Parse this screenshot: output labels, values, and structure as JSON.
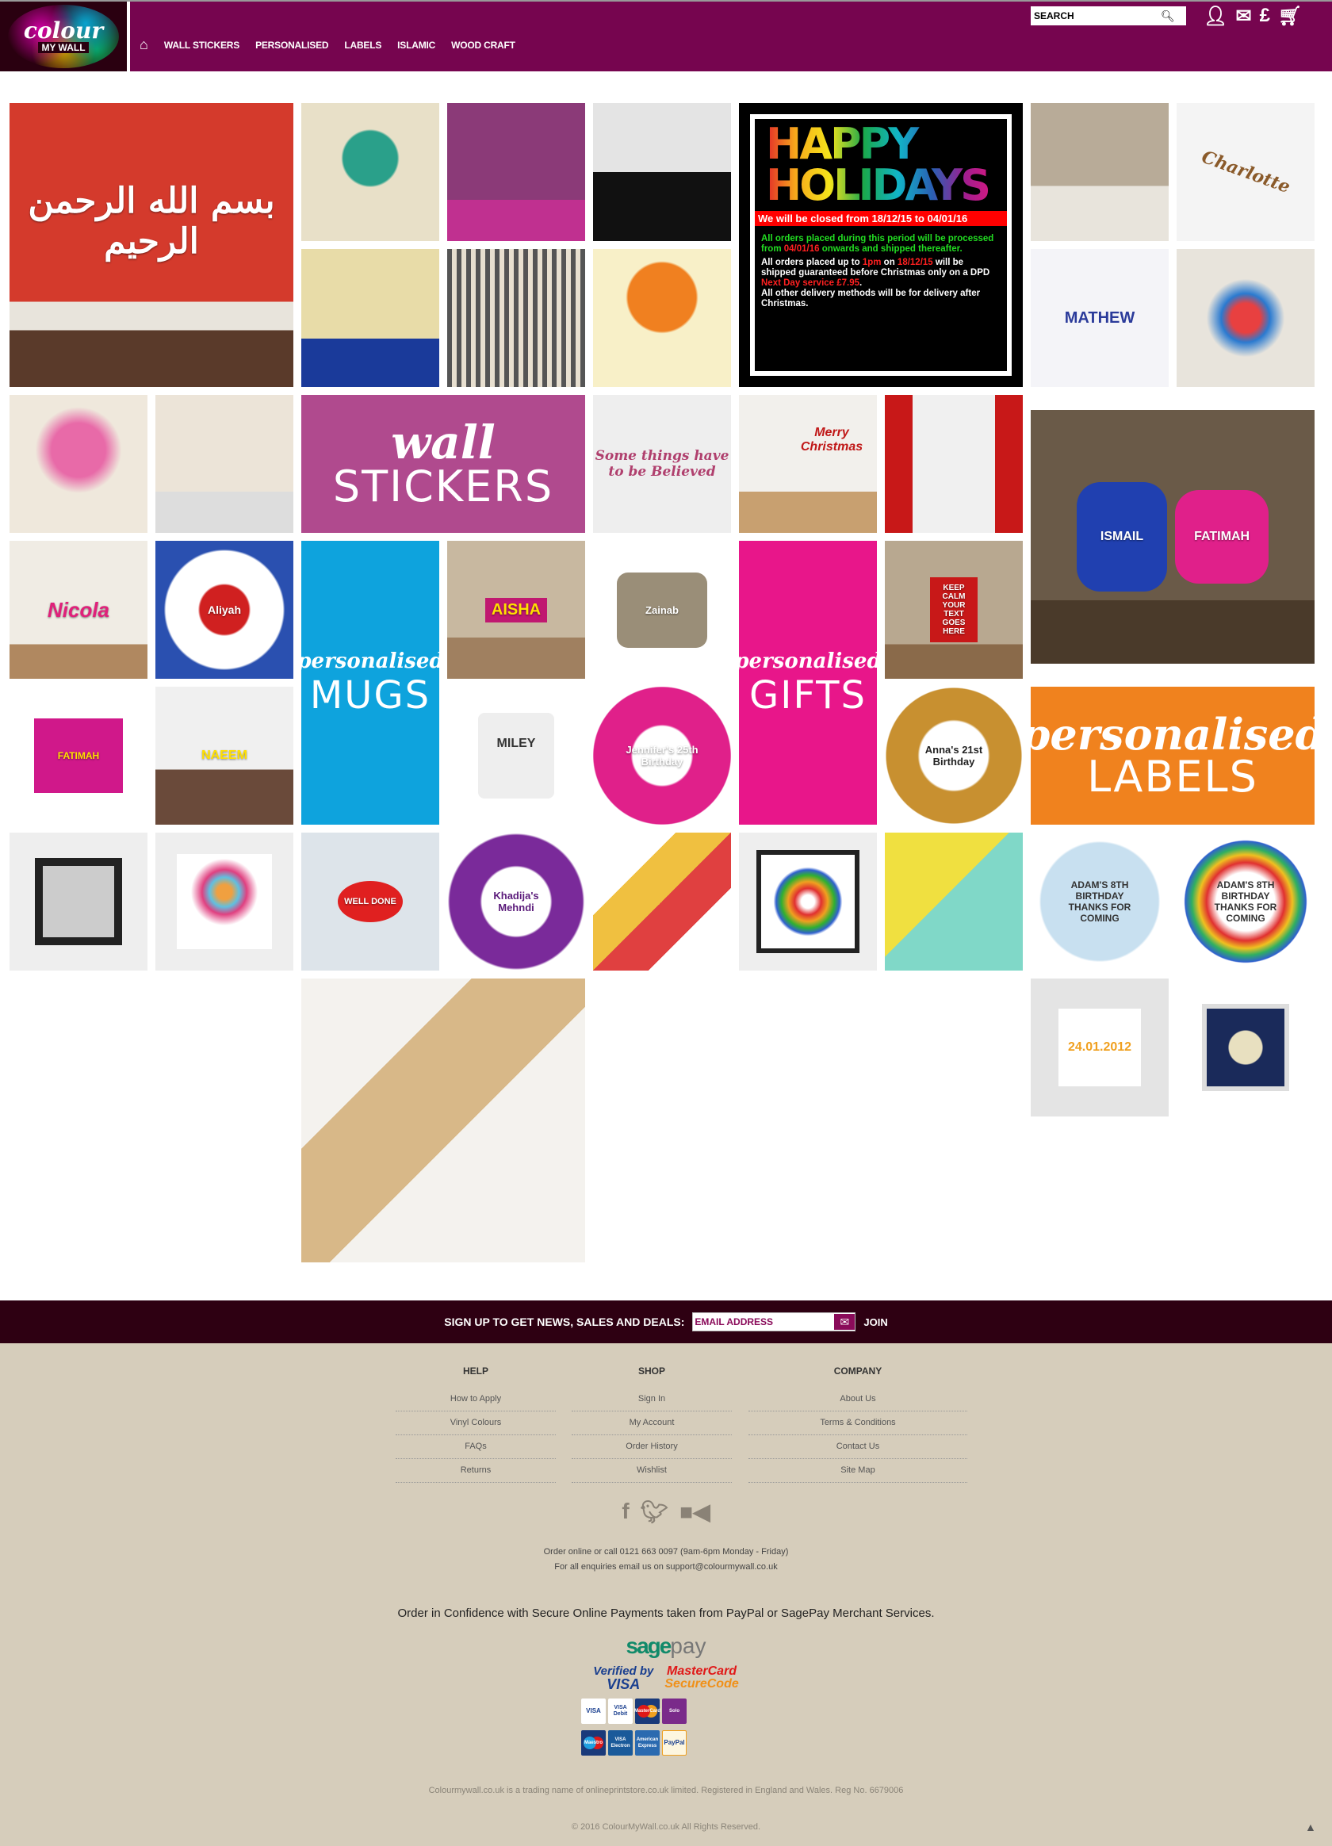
{
  "header": {
    "logo": {
      "line1": "colour",
      "line2": "MY WALL"
    },
    "nav": [
      "WALL STICKERS",
      "PERSONALISED",
      "LABELS",
      "ISLAMIC",
      "WOOD CRAFT"
    ],
    "search_placeholder": "SEARCH",
    "icons": [
      "home-icon",
      "search-icon",
      "user-icon",
      "mail-icon",
      "currency-pound-icon",
      "basket-icon"
    ],
    "brand_color": "#76054f"
  },
  "grid": {
    "holiday": {
      "title1": "HAPPY",
      "title2": "HOLIDAYS",
      "closed": "We will be closed from 18/12/15 to 04/01/16",
      "p1a": "All orders placed during this period will be processed from ",
      "p1b": "04/01/16",
      "p1c": " onwards and shipped thereafter.",
      "p2a": "All orders placed up to ",
      "p2b": "1pm",
      "p2c": " on ",
      "p2d": "18/12/15",
      "p2e": " will be shipped guaranteed before Christmas only on a DPD ",
      "p2f": "Next Day service £7.95",
      "p3": "All other delivery methods will be for delivery after Christmas."
    },
    "banners": {
      "stickers": {
        "script": "wall",
        "big": "STICKERS",
        "color": "#b04a8e"
      },
      "mugs": {
        "script": "personalised",
        "big": "MUGS",
        "color": "#0ea3dd"
      },
      "gifts": {
        "script": "personalised",
        "big": "GIFTS",
        "color": "#e8168a"
      },
      "labels": {
        "script": "personalised",
        "big": "LABELS",
        "color": "#f0821e"
      }
    },
    "products": {
      "charlotte": "Charlotte",
      "believed": "Some things have to be Believed",
      "merry": "Merry Christmas",
      "mathew": "MATHEW",
      "ismail": "ISMAIL",
      "fatimah": "FATIMAH",
      "nicola": "Nicola",
      "aliyah": "Aliyah",
      "aisha": "AISHA",
      "zainab": "Zainab",
      "keepcalm": "KEEP CALM YOUR TEXT GOES HERE",
      "fatima_tee": "FATIMAH",
      "naeem": "NAEEM",
      "miley": "MILEY",
      "jennifer": "Jennifer's 25th Birthday",
      "anna": "Anna's 21st Birthday",
      "khadija": "Khadija's Mehndi",
      "adams": "ADAM'S 8TH BIRTHDAY THANKS FOR COMING",
      "well_done": "WELL DONE",
      "abdur": "24.01.2012"
    }
  },
  "signup": {
    "label": "SIGN UP TO GET NEWS, SALES AND DEALS:",
    "placeholder": "EMAIL ADDRESS",
    "join": "JOIN"
  },
  "footer": {
    "columns": [
      {
        "title": "HELP",
        "links": [
          "How to Apply",
          "Vinyl Colours",
          "FAQs",
          "Returns"
        ]
      },
      {
        "title": "SHOP",
        "links": [
          "Sign In",
          "My Account",
          "Order History",
          "Wishlist"
        ]
      },
      {
        "title": "COMPANY",
        "links": [
          "About Us",
          "Terms & Conditions",
          "Contact Us",
          "Site Map"
        ]
      }
    ],
    "social": [
      "facebook-icon",
      "twitter-icon",
      "video-icon"
    ],
    "contact1": "Order online or call 0121 663 0097 (9am-6pm Monday - Friday)",
    "contact2": "For all enquiries email us on support@colourmywall.co.uk",
    "confidence": "Order in Confidence with Secure Online Payments taken from PayPal or SagePay Merchant Services.",
    "sagepay": {
      "a": "sage",
      "b": "pay"
    },
    "vbv": {
      "a": "Verified by",
      "b": "VISA"
    },
    "msc": {
      "a": "MasterCard",
      "b": "SecureCode"
    },
    "cards": [
      "VISA",
      "VISA Debit",
      "MasterCard",
      "Solo",
      "Maestro",
      "VISA Electron",
      "American Express",
      "PayPal"
    ],
    "legal": "Colourmywall.co.uk is a trading name of onlineprintstore.co.uk limited. Registered in England and Wales. Reg No. 6679006",
    "copyright": "© 2016 ColourMyWall.co.uk All Rights Reserved."
  }
}
